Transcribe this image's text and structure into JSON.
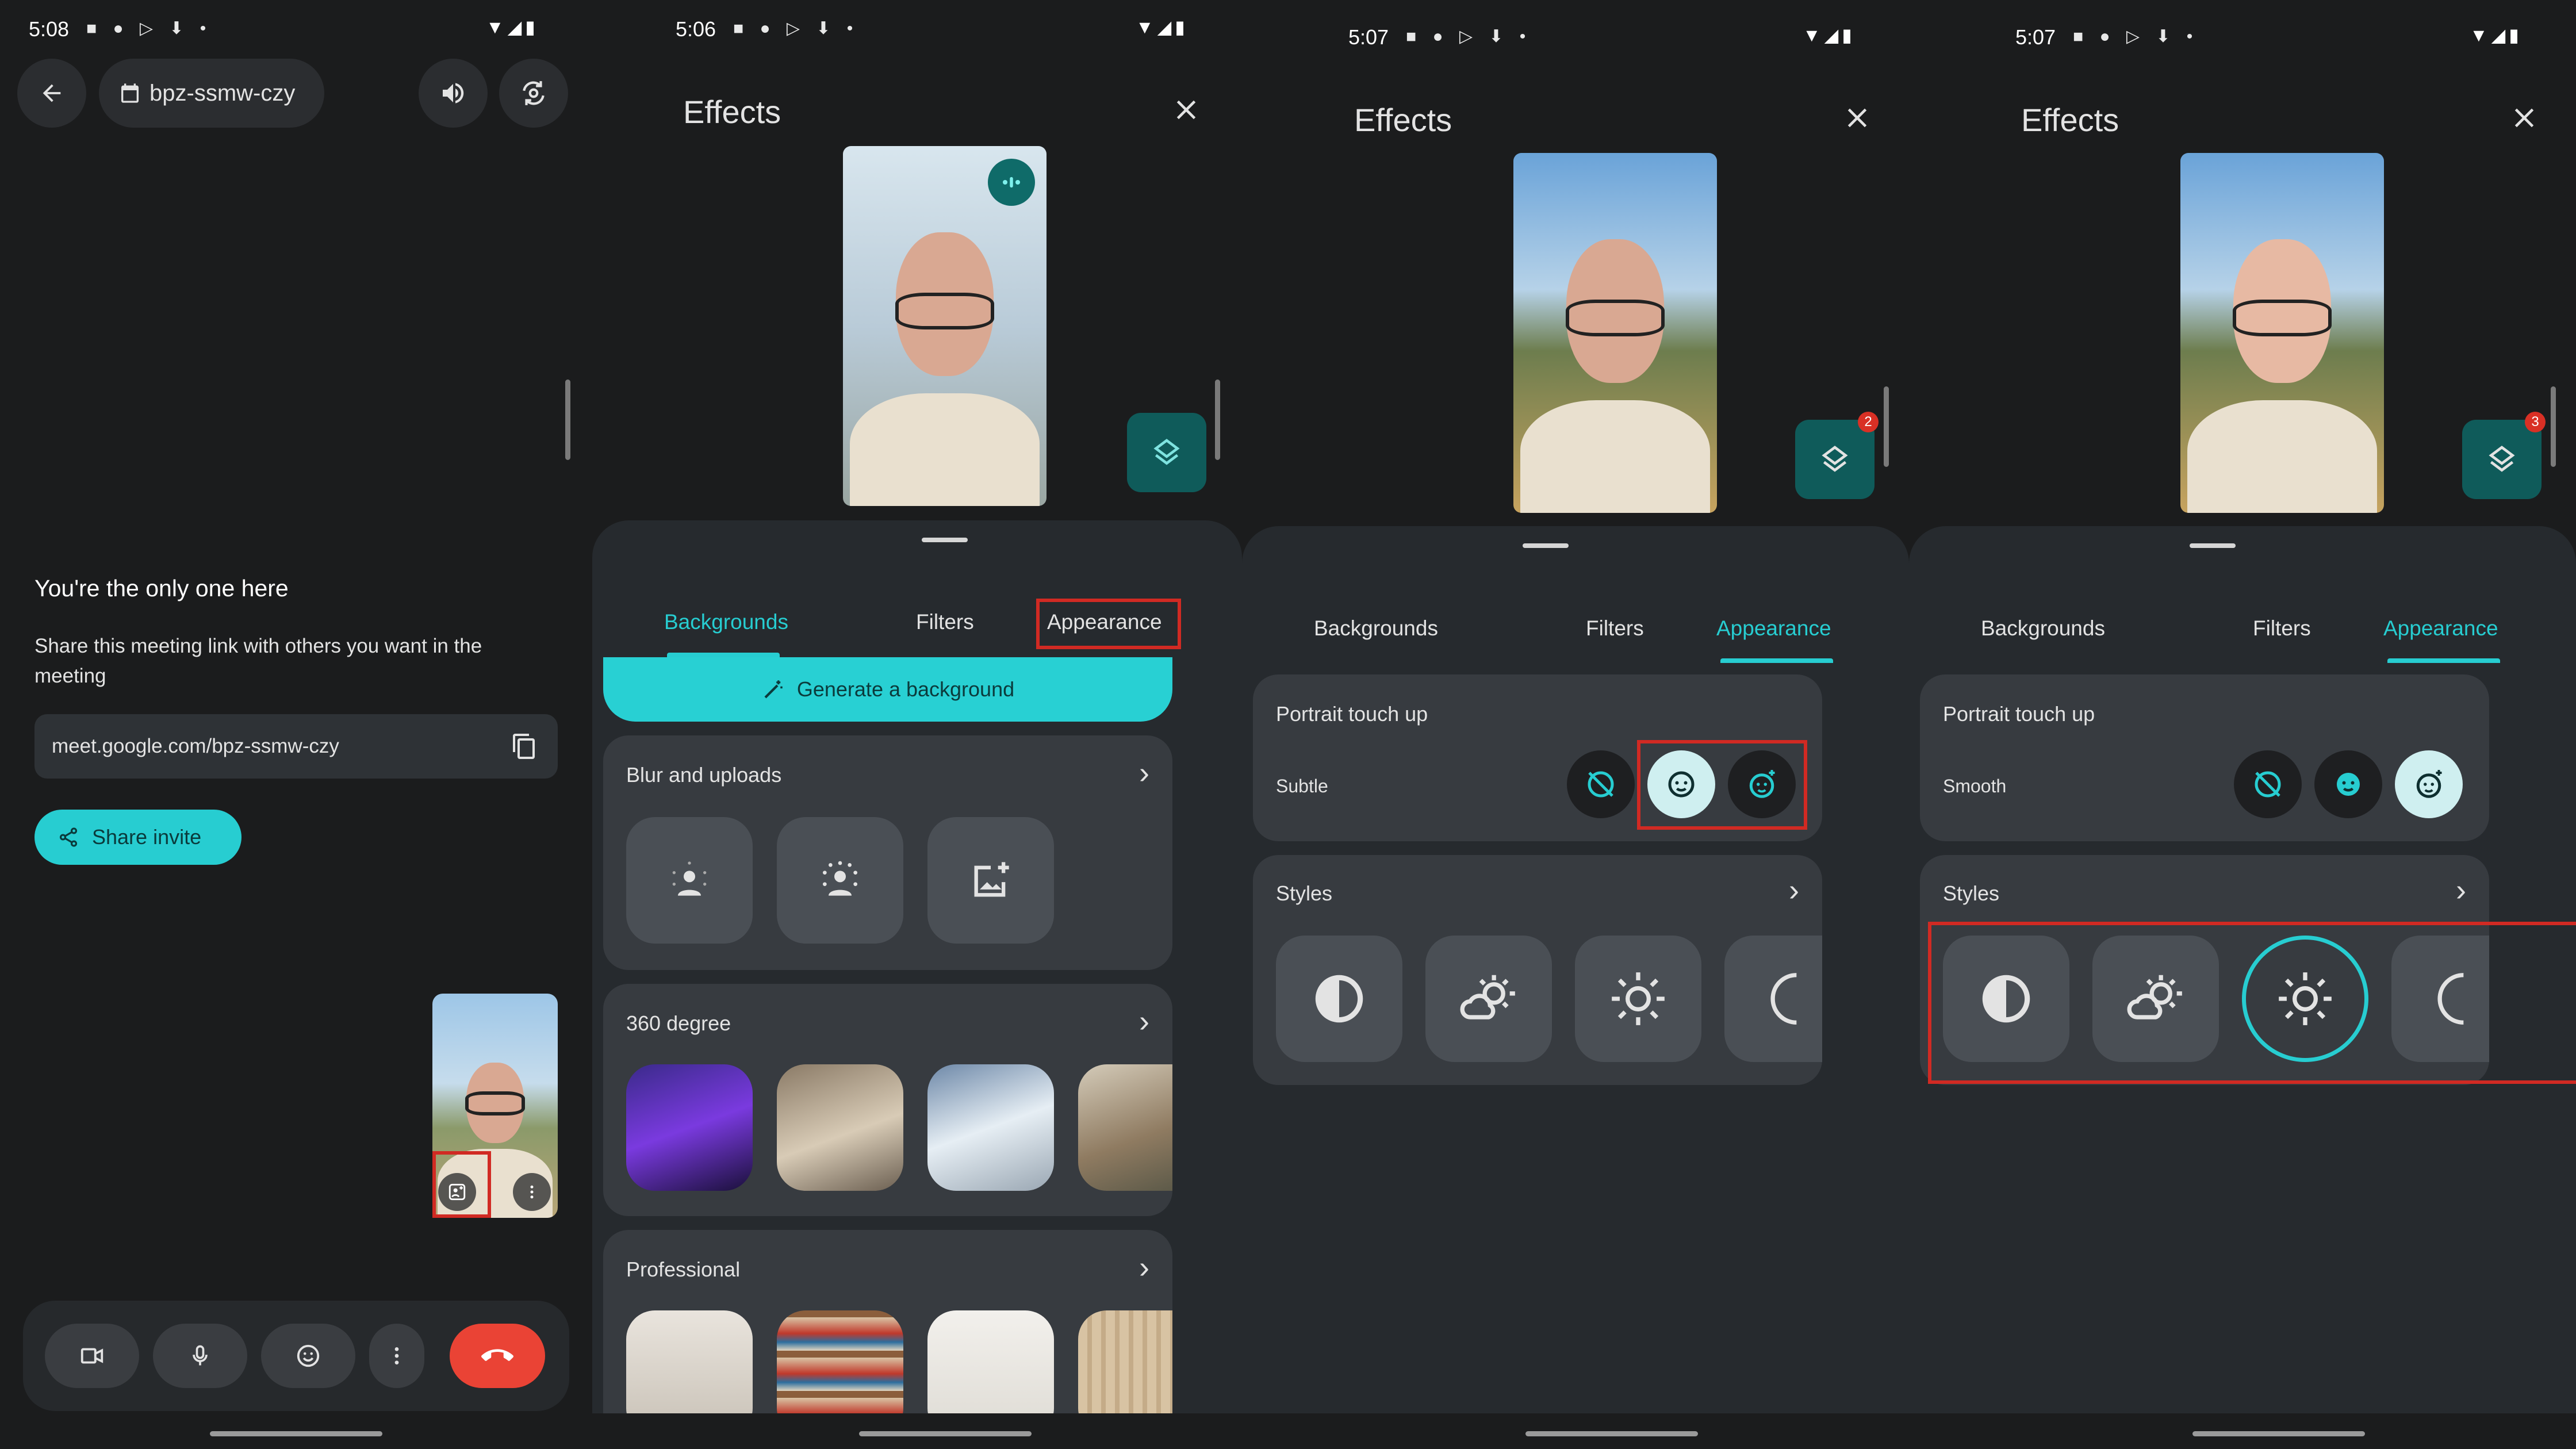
{
  "colors": {
    "accent": "#27cdd1",
    "highlight": "#d12a23",
    "bg": "#1b1c1d",
    "sheet": "#262a2e",
    "card": "#373b40",
    "end_call": "#ea4335"
  },
  "panel1": {
    "status_time": "5:08",
    "meeting_code": "bpz-ssmw-czy",
    "heading": "You're the only one here",
    "description": "Share this meeting link with others you want in the meeting",
    "meeting_link": "meet.google.com/bpz-ssmw-czy",
    "share_label": "Share invite",
    "icons": [
      "back-arrow-icon",
      "calendar-icon",
      "speaker-icon",
      "switch-camera-icon",
      "copy-icon",
      "share-icon",
      "effects-icon",
      "more-vert-icon",
      "camera-icon",
      "mic-icon",
      "emoji-icon",
      "end-call-icon"
    ]
  },
  "panel2": {
    "status_time": "5:06",
    "title": "Effects",
    "tabs": [
      "Backgrounds",
      "Filters",
      "Appearance"
    ],
    "generate_label": "Generate a background",
    "sections": [
      {
        "title": "Blur and uploads"
      },
      {
        "title": "360 degree"
      },
      {
        "title": "Professional"
      }
    ]
  },
  "panel3": {
    "status_time": "5:07",
    "title": "Effects",
    "tabs": [
      "Backgrounds",
      "Filters",
      "Appearance"
    ],
    "badge": "2",
    "touchup_title": "Portrait touch up",
    "touchup_level": "Subtle",
    "styles_title": "Styles"
  },
  "panel4": {
    "status_time": "5:07",
    "title": "Effects",
    "tabs": [
      "Backgrounds",
      "Filters",
      "Appearance"
    ],
    "badge": "3",
    "touchup_title": "Portrait touch up",
    "touchup_level": "Smooth",
    "styles_title": "Styles"
  }
}
